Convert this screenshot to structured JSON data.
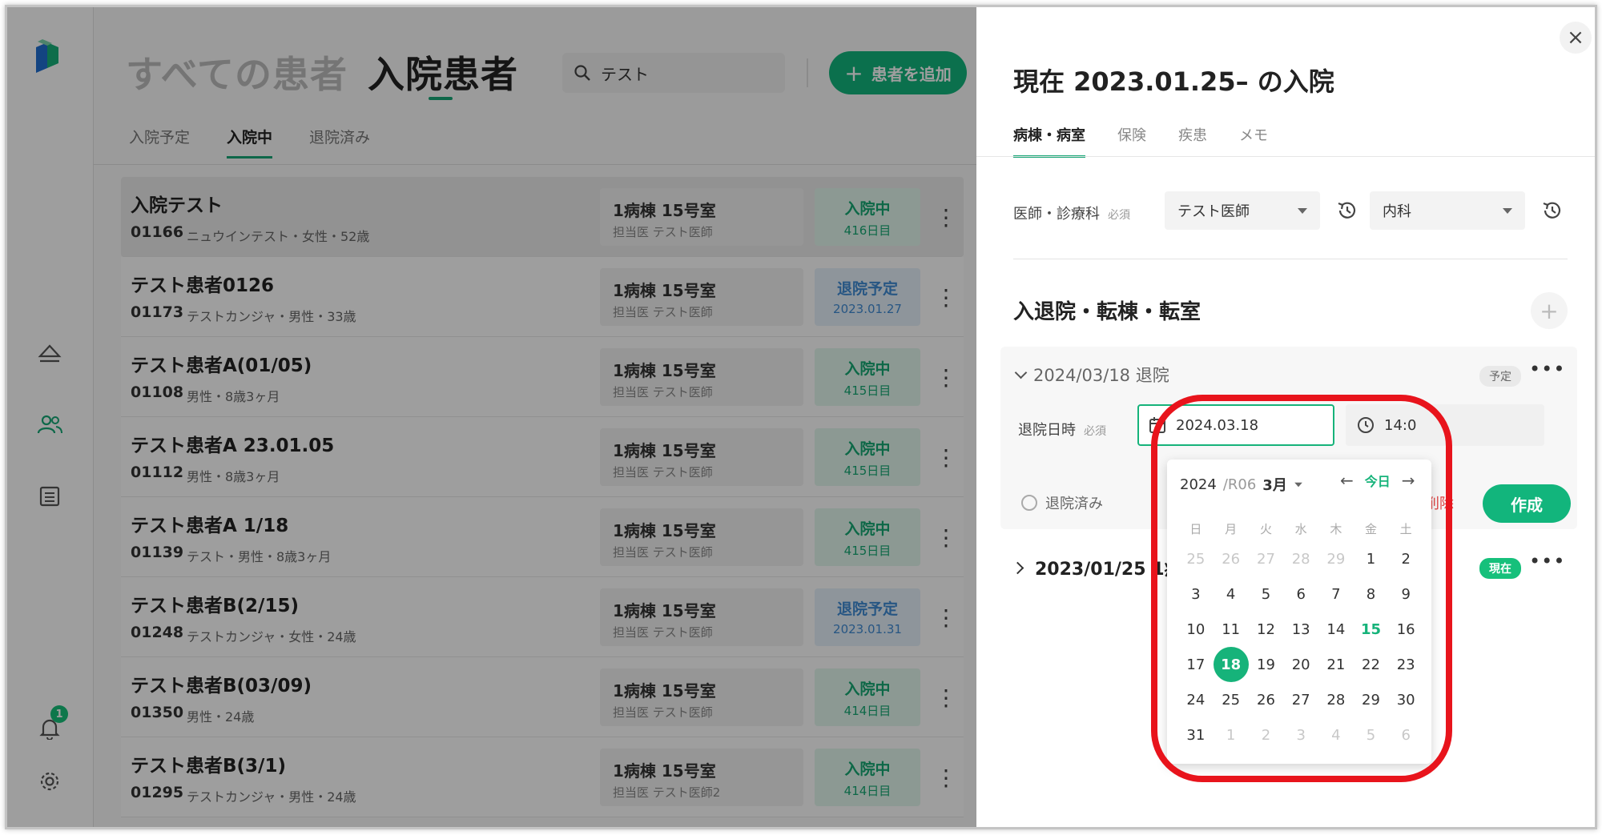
{
  "main": {
    "title_all": "すべての患者",
    "title_inpatient": "入院患者",
    "search_value": "テスト",
    "add_button": "患者を追加",
    "tabs": [
      {
        "label": "入院予定"
      },
      {
        "label": "入院中"
      },
      {
        "label": "退院済み"
      }
    ],
    "patients": [
      {
        "name": "入院テスト",
        "id": "01166",
        "meta": "ニュウインテスト・女性・52歳",
        "room": "1病棟 15号室",
        "doctor": "担当医 テスト医師",
        "status": "入院中",
        "status_sub": "416日目",
        "status_type": "in"
      },
      {
        "name": "テスト患者0126",
        "id": "01173",
        "meta": "テストカンジャ・男性・33歳",
        "room": "1病棟 15号室",
        "doctor": "担当医 テスト医師",
        "status": "退院予定",
        "status_sub": "2023.01.27",
        "status_type": "out"
      },
      {
        "name": "テスト患者A(01/05)",
        "id": "01108",
        "meta": "男性・8歳3ヶ月",
        "room": "1病棟 15号室",
        "doctor": "担当医 テスト医師",
        "status": "入院中",
        "status_sub": "415日目",
        "status_type": "in"
      },
      {
        "name": "テスト患者A 23.01.05",
        "id": "01112",
        "meta": "男性・8歳3ヶ月",
        "room": "1病棟 15号室",
        "doctor": "担当医 テスト医師",
        "status": "入院中",
        "status_sub": "415日目",
        "status_type": "in"
      },
      {
        "name": "テスト患者A 1/18",
        "id": "01139",
        "meta": "テスト・男性・8歳3ヶ月",
        "room": "1病棟 15号室",
        "doctor": "担当医 テスト医師",
        "status": "入院中",
        "status_sub": "415日目",
        "status_type": "in"
      },
      {
        "name": "テスト患者B(2/15)",
        "id": "01248",
        "meta": "テストカンジャ・女性・24歳",
        "room": "1病棟 15号室",
        "doctor": "担当医 テスト医師",
        "status": "退院予定",
        "status_sub": "2023.01.31",
        "status_type": "out"
      },
      {
        "name": "テスト患者B(03/09)",
        "id": "01350",
        "meta": "男性・24歳",
        "room": "1病棟 15号室",
        "doctor": "担当医 テスト医師",
        "status": "入院中",
        "status_sub": "414日目",
        "status_type": "in"
      },
      {
        "name": "テスト患者B(3/1)",
        "id": "01295",
        "meta": "テストカンジャ・男性・24歳",
        "room": "1病棟 15号室",
        "doctor": "担当医 テスト医師2",
        "status": "入院中",
        "status_sub": "414日目",
        "status_type": "in"
      }
    ]
  },
  "nav": {
    "notification_count": "1"
  },
  "panel": {
    "title": "現在 2023.01.25– の入院",
    "tabs": [
      {
        "label": "病棟・病室"
      },
      {
        "label": "保険"
      },
      {
        "label": "疾患"
      },
      {
        "label": "メモ"
      }
    ],
    "doctor_label": "医師・診療科",
    "required": "必須",
    "doctor_value": "テスト医師",
    "dept_value": "内科",
    "section_title": "入退院・転棟・転室",
    "discharge_header": "2024/03/18 退院",
    "discharge_tag": "予定",
    "discharge_datetime_label": "退院日時",
    "discharge_date": "2024.03.18",
    "discharge_time": "14:0",
    "discharged_label": "退院済み",
    "delete_label": "削除",
    "create_button": "作成",
    "admission_header": "2023/01/25 1病",
    "admission_tag": "現在"
  },
  "calendar": {
    "year": "2024",
    "era": "/R06",
    "month": "3月",
    "today_label": "今日",
    "weekdays": [
      "日",
      "月",
      "火",
      "水",
      "木",
      "金",
      "土"
    ],
    "days": [
      {
        "d": "25",
        "m": true
      },
      {
        "d": "26",
        "m": true
      },
      {
        "d": "27",
        "m": true
      },
      {
        "d": "28",
        "m": true
      },
      {
        "d": "29",
        "m": true
      },
      {
        "d": "1"
      },
      {
        "d": "2"
      },
      {
        "d": "3"
      },
      {
        "d": "4"
      },
      {
        "d": "5"
      },
      {
        "d": "6"
      },
      {
        "d": "7"
      },
      {
        "d": "8"
      },
      {
        "d": "9"
      },
      {
        "d": "10"
      },
      {
        "d": "11"
      },
      {
        "d": "12"
      },
      {
        "d": "13"
      },
      {
        "d": "14"
      },
      {
        "d": "15",
        "t": true
      },
      {
        "d": "16"
      },
      {
        "d": "17"
      },
      {
        "d": "18",
        "s": true
      },
      {
        "d": "19"
      },
      {
        "d": "20"
      },
      {
        "d": "21"
      },
      {
        "d": "22"
      },
      {
        "d": "23"
      },
      {
        "d": "24"
      },
      {
        "d": "25"
      },
      {
        "d": "26"
      },
      {
        "d": "27"
      },
      {
        "d": "28"
      },
      {
        "d": "29"
      },
      {
        "d": "30"
      },
      {
        "d": "31"
      },
      {
        "d": "1",
        "m": true
      },
      {
        "d": "2",
        "m": true
      },
      {
        "d": "3",
        "m": true
      },
      {
        "d": "4",
        "m": true
      },
      {
        "d": "5",
        "m": true
      },
      {
        "d": "6",
        "m": true
      }
    ]
  },
  "colors": {
    "accent": "#12b57c",
    "highlight_ring": "#e8141c",
    "danger": "#e04343"
  }
}
